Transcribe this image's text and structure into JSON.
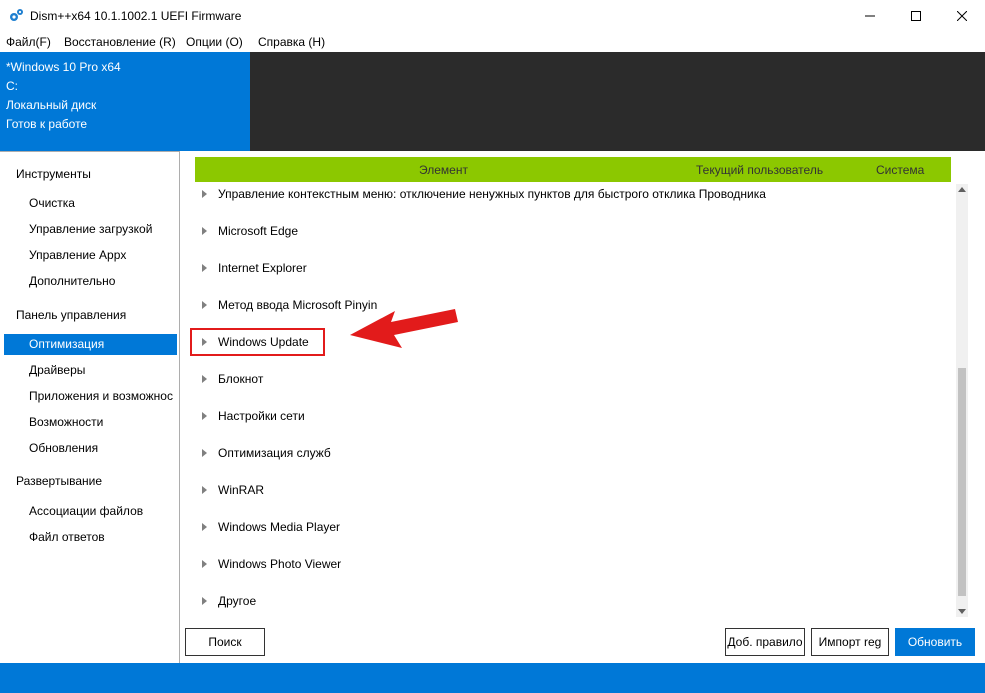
{
  "window": {
    "title": "Dism++x64 10.1.1002.1 UEFI Firmware"
  },
  "menu": [
    "Файл(F)",
    "Восстановление (R)",
    "Опции (O)",
    "Справка (H)"
  ],
  "info": {
    "os": "*Windows 10 Pro x64",
    "drive": "C:",
    "disk": "Локальный диск",
    "status": "Готов к работе"
  },
  "sidebar": {
    "groups": [
      {
        "label": "Инструменты",
        "items": [
          "Очистка",
          "Управление загрузкой",
          "Управление Appx",
          "Дополнительно"
        ]
      },
      {
        "label": "Панель управления",
        "items": [
          "Оптимизация",
          "Драйверы",
          "Приложения и возможнос",
          "Возможности",
          "Обновления"
        ]
      },
      {
        "label": "Развертывание",
        "items": [
          "Ассоциации файлов",
          "Файл ответов"
        ]
      }
    ],
    "selected": "Оптимизация"
  },
  "table": {
    "columns": [
      "Элемент",
      "Текущий пользователь",
      "Система"
    ],
    "rows": [
      "Управление контекстным меню: отключение ненужных пунктов для быстрого отклика Проводника",
      "Microsoft Edge",
      "Internet Explorer",
      "Метод ввода Microsoft Pinyin",
      "Windows Update",
      "Блокнот",
      "Настройки сети",
      "Оптимизация служб",
      "WinRAR",
      "Windows Media Player",
      "Windows Photo Viewer",
      "Другое"
    ],
    "highlighted_row": "Windows Update"
  },
  "buttons": {
    "search": "Поиск",
    "add_rule": "Доб. правило",
    "import_reg": "Импорт reg",
    "refresh": "Обновить"
  },
  "colors": {
    "accent": "#0078d7",
    "header_green": "#8cc800",
    "highlight_red": "#e21b1b"
  }
}
